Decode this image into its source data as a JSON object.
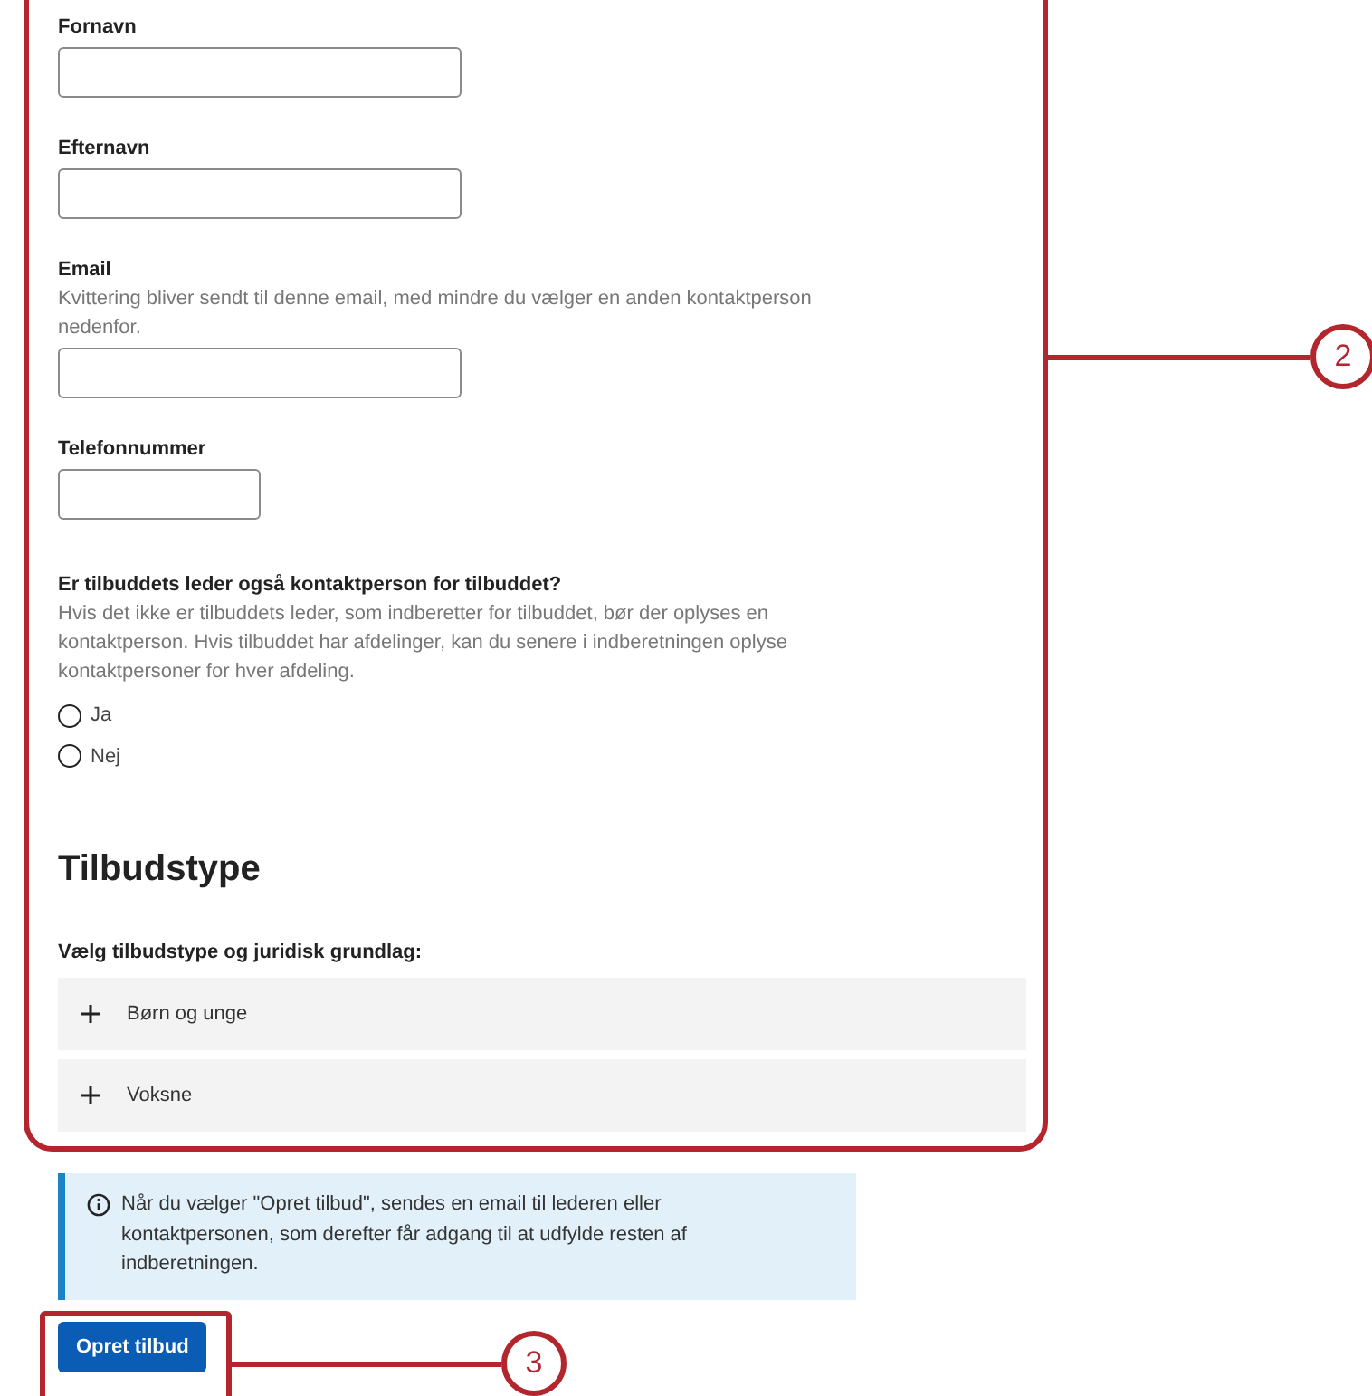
{
  "contact_fields": [
    {
      "label": "Fornavn",
      "kind": "wide"
    },
    {
      "label": "Efternavn",
      "kind": "wide"
    },
    {
      "label": "Email",
      "help": "Kvittering bliver sendt til denne email, med mindre du vælger en anden kontaktperson nedenfor.",
      "kind": "wide"
    },
    {
      "label": "Telefonnummer",
      "kind": "narrow"
    }
  ],
  "contact_question": {
    "label": "Er tilbuddets leder også kontaktperson for tilbuddet?",
    "help": "Hvis det ikke er tilbuddets leder, som indberetter for tilbuddet, bør der oplyses en kontaktperson. Hvis tilbuddet har afdelinger, kan du senere i indberetningen oplyse kontaktpersoner for hver afdeling.",
    "options": [
      {
        "label": "Ja",
        "selected": false
      },
      {
        "label": "Nej",
        "selected": false
      }
    ]
  },
  "offer_type": {
    "heading": "Tilbudstype",
    "prompt": "Vælg tilbudstype og juridisk grundlag:",
    "sections": [
      {
        "label": "Børn og unge",
        "expanded": false
      },
      {
        "label": "Voksne",
        "expanded": false
      }
    ]
  },
  "info_notice": "Når du vælger \"Opret tilbud\", sendes en email til lederen eller kontaktpersonen, som derefter får adgang til at udfylde resten af indberetningen.",
  "submit_button": "Opret tilbud",
  "callouts": [
    {
      "label": "2"
    },
    {
      "label": "3"
    }
  ]
}
